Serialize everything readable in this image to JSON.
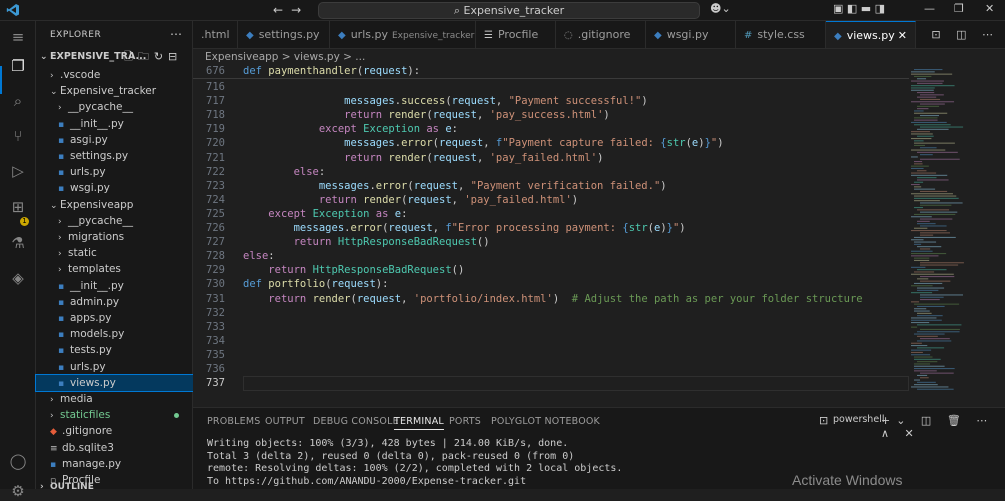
{
  "titlebar": {
    "search_text": "Expensive_tracker",
    "nav_back": "←",
    "nav_forward": "→"
  },
  "activity": {
    "badge": "1"
  },
  "sidebar": {
    "title": "EXPLORER",
    "root": "EXPENSIVE_TRA...",
    "items": [
      {
        "label": ".vscode",
        "type": "folder",
        "depth": 1,
        "open": false
      },
      {
        "label": "Expensive_tracker",
        "type": "folder",
        "depth": 1,
        "open": true
      },
      {
        "label": "__pycache__",
        "type": "folder",
        "depth": 2,
        "open": false
      },
      {
        "label": "__init__.py",
        "type": "py",
        "depth": 2
      },
      {
        "label": "asgi.py",
        "type": "py",
        "depth": 2
      },
      {
        "label": "settings.py",
        "type": "py",
        "depth": 2
      },
      {
        "label": "urls.py",
        "type": "py",
        "depth": 2
      },
      {
        "label": "wsgi.py",
        "type": "py",
        "depth": 2
      },
      {
        "label": "Expensiveapp",
        "type": "folder",
        "depth": 1,
        "open": true
      },
      {
        "label": "__pycache__",
        "type": "folder",
        "depth": 2,
        "open": false
      },
      {
        "label": "migrations",
        "type": "folder",
        "depth": 2,
        "open": false
      },
      {
        "label": "static",
        "type": "folder",
        "depth": 2,
        "open": false
      },
      {
        "label": "templates",
        "type": "folder",
        "depth": 2,
        "open": false
      },
      {
        "label": "__init__.py",
        "type": "py",
        "depth": 2
      },
      {
        "label": "admin.py",
        "type": "py",
        "depth": 2
      },
      {
        "label": "apps.py",
        "type": "py",
        "depth": 2
      },
      {
        "label": "models.py",
        "type": "py",
        "depth": 2
      },
      {
        "label": "tests.py",
        "type": "py",
        "depth": 2
      },
      {
        "label": "urls.py",
        "type": "py",
        "depth": 2
      },
      {
        "label": "views.py",
        "type": "py",
        "depth": 2,
        "selected": true
      },
      {
        "label": "media",
        "type": "folder",
        "depth": 1,
        "open": false
      },
      {
        "label": "staticfiles",
        "type": "folder",
        "depth": 1,
        "open": false,
        "color": "#73c991"
      },
      {
        "label": ".gitignore",
        "type": "git",
        "depth": 1
      },
      {
        "label": "db.sqlite3",
        "type": "db",
        "depth": 1
      },
      {
        "label": "manage.py",
        "type": "py",
        "depth": 1
      },
      {
        "label": "Procfile",
        "type": "file",
        "depth": 1
      }
    ],
    "outline": "OUTLINE"
  },
  "tabs": [
    {
      "label": ".html",
      "icon": "html",
      "desc": ""
    },
    {
      "label": "settings.py",
      "icon": "py",
      "desc": ""
    },
    {
      "label": "urls.py",
      "icon": "py",
      "desc": "Expensive_tracker"
    },
    {
      "label": "Procfile",
      "icon": "file",
      "desc": ""
    },
    {
      "label": ".gitignore",
      "icon": "git",
      "desc": ""
    },
    {
      "label": "wsgi.py",
      "icon": "py",
      "desc": ""
    },
    {
      "label": "style.css",
      "icon": "css",
      "desc": ""
    },
    {
      "label": "views.py",
      "icon": "py",
      "desc": "",
      "active": true
    }
  ],
  "breadcrumbs": "Expensiveapp > views.py > ...",
  "code": {
    "sticky": {
      "line": 676,
      "text": "def paymenthandler(request):"
    },
    "lines": [
      {
        "n": 716,
        "html": ""
      },
      {
        "n": 717,
        "html": "                <span class='vr'>messages</span>.<span class='fn'>success</span>(<span class='vr'>request</span>, <span class='st'>\"Payment successful!\"</span>)"
      },
      {
        "n": 718,
        "html": "                <span class='kc'>return</span> <span class='fn'>render</span>(<span class='vr'>request</span>, <span class='st'>'pay_success.html'</span>)"
      },
      {
        "n": 719,
        "html": "            <span class='kc'>except</span> <span class='ty'>Exception</span> <span class='kc'>as</span> <span class='vr'>e</span>:"
      },
      {
        "n": 720,
        "html": "                <span class='vr'>messages</span>.<span class='fn'>error</span>(<span class='vr'>request</span>, <span class='kw'>f</span><span class='st'>\"Payment capture failed: </span><span class='kw'>{</span><span class='ty'>str</span>(<span class='vr'>e</span>)<span class='kw'>}</span><span class='st'>\"</span>)"
      },
      {
        "n": 721,
        "html": "                <span class='kc'>return</span> <span class='fn'>render</span>(<span class='vr'>request</span>, <span class='st'>'pay_failed.html'</span>)"
      },
      {
        "n": 722,
        "html": "        <span class='kc'>else</span>:"
      },
      {
        "n": 723,
        "html": "            <span class='vr'>messages</span>.<span class='fn'>error</span>(<span class='vr'>request</span>, <span class='st'>\"Payment verification failed.\"</span>)"
      },
      {
        "n": 724,
        "html": "            <span class='kc'>return</span> <span class='fn'>render</span>(<span class='vr'>request</span>, <span class='st'>'pay_failed.html'</span>)"
      },
      {
        "n": 725,
        "html": "    <span class='kc'>except</span> <span class='ty'>Exception</span> <span class='kc'>as</span> <span class='vr'>e</span>:"
      },
      {
        "n": 726,
        "html": "        <span class='vr'>messages</span>.<span class='fn'>error</span>(<span class='vr'>request</span>, <span class='kw'>f</span><span class='st'>\"Error processing payment: </span><span class='kw'>{</span><span class='ty'>str</span>(<span class='vr'>e</span>)<span class='kw'>}</span><span class='st'>\"</span>)"
      },
      {
        "n": 727,
        "html": "        <span class='kc'>return</span> <span class='ty'>HttpResponseBadRequest</span>()"
      },
      {
        "n": 728,
        "html": "<span class='kc'>else</span>:"
      },
      {
        "n": 729,
        "html": "    <span class='kc'>return</span> <span class='ty'>HttpResponseBadRequest</span>()"
      },
      {
        "n": 730,
        "html": "<span class='kw'>def</span> <span class='fn'>portfolio</span>(<span class='vr'>request</span>):"
      },
      {
        "n": 731,
        "html": "    <span class='kc'>return</span> <span class='fn'>render</span>(<span class='vr'>request</span>, <span class='st'>'portfolio/index.html'</span>)  <span class='cm'># Adjust the path as per your folder structure</span>"
      },
      {
        "n": 732,
        "html": ""
      },
      {
        "n": 733,
        "html": ""
      },
      {
        "n": 734,
        "html": ""
      },
      {
        "n": 735,
        "html": ""
      },
      {
        "n": 736,
        "html": ""
      },
      {
        "n": 737,
        "html": "",
        "current": true
      }
    ]
  },
  "panel": {
    "tabs": [
      "PROBLEMS",
      "OUTPUT",
      "DEBUG CONSOLE",
      "TERMINAL",
      "PORTS",
      "POLYGLOT NOTEBOOK"
    ],
    "active_tab": "TERMINAL",
    "shell": "powershell",
    "terminal_lines": [
      "Writing objects: 100% (3/3), 428 bytes | 214.00 KiB/s, done.",
      "Total 3 (delta 2), reused 0 (delta 0), pack-reused 0 (from 0)",
      "remote: Resolving deltas: 100% (2/2), completed with 2 local objects.",
      "To https://github.com/ANANDU-2000/Expense-tracker.git"
    ]
  },
  "watermark": "Activate Windows",
  "colors": {
    "accent": "#0078d4",
    "selected_row": "#04395e",
    "badge": "#cca700"
  }
}
